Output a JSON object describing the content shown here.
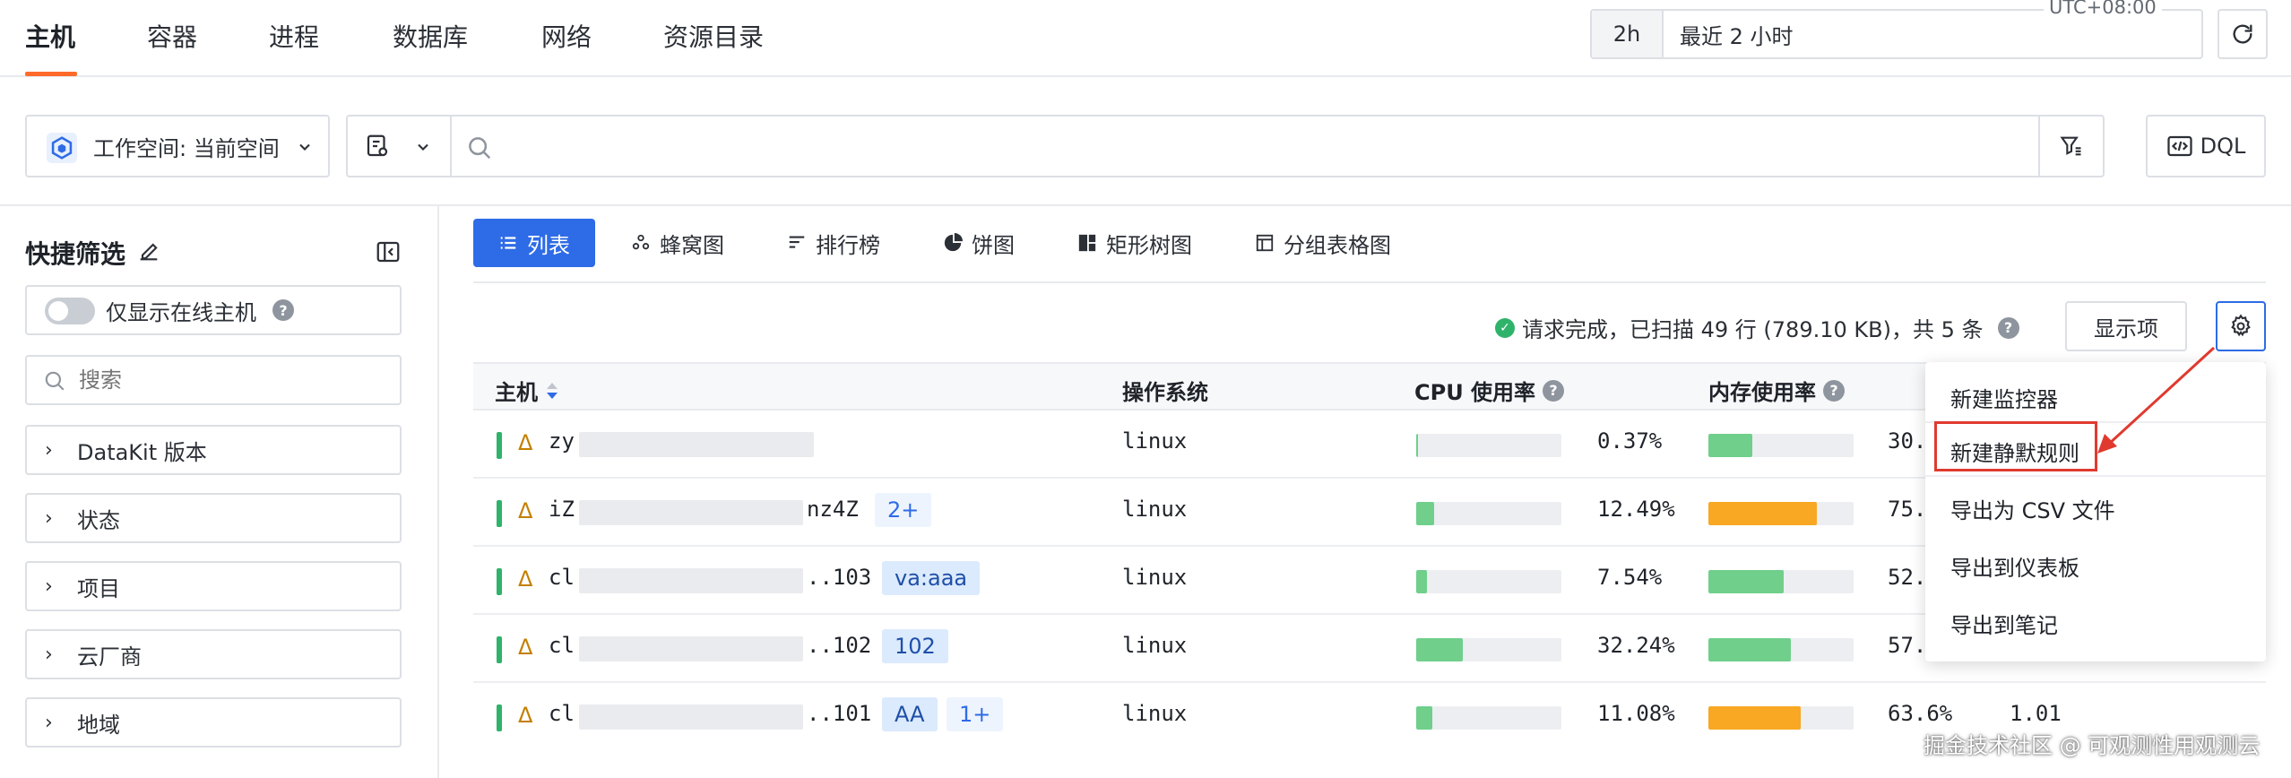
{
  "topnav": {
    "tabs": [
      {
        "label": "主机",
        "active": true
      },
      {
        "label": "容器"
      },
      {
        "label": "进程"
      },
      {
        "label": "数据库"
      },
      {
        "label": "网络"
      },
      {
        "label": "资源目录"
      }
    ]
  },
  "time": {
    "short": "2h",
    "range": "最近 2 小时",
    "timezone": "UTC+08:00"
  },
  "workspace": {
    "label": "工作空间: 当前空间"
  },
  "search": {
    "placeholder": ""
  },
  "dql_label": "DQL",
  "sidebar": {
    "title": "快捷筛选",
    "online_toggle_label": "仅显示在线主机",
    "online_toggle_on": false,
    "search_placeholder": "搜索",
    "groups": [
      "DataKit 版本",
      "状态",
      "项目",
      "云厂商",
      "地域"
    ]
  },
  "views": [
    "列表",
    "蜂窝图",
    "排行榜",
    "饼图",
    "矩形树图",
    "分组表格图"
  ],
  "status": {
    "text": "请求完成，已扫描 49 行 (789.10 KB)，共 5 条"
  },
  "show_columns_label": "显示项",
  "table": {
    "headers": {
      "host": "主机",
      "os": "操作系统",
      "cpu": "CPU 使用率",
      "mem": "内存使用率"
    },
    "rows": [
      {
        "host": "zy",
        "suffix": "",
        "tags": [],
        "os": "linux",
        "cpu": 0.37,
        "cpu_label": "0.37%",
        "mem": 30,
        "mem_label": "30.",
        "load": ""
      },
      {
        "host": "iZ",
        "suffix": "nz4Z",
        "tags": [
          "2+"
        ],
        "os": "linux",
        "cpu": 12.49,
        "cpu_label": "12.49%",
        "mem": 75,
        "mem_label": "75.",
        "load": ""
      },
      {
        "host": "cl",
        "suffix": "..103",
        "tags": [
          "va:aaa"
        ],
        "os": "linux",
        "cpu": 7.54,
        "cpu_label": "7.54%",
        "mem": 52,
        "mem_label": "52.",
        "load": ""
      },
      {
        "host": "cl",
        "suffix": "..102",
        "tags": [
          "102"
        ],
        "os": "linux",
        "cpu": 32.24,
        "cpu_label": "32.24%",
        "mem": 57,
        "mem_label": "57.",
        "load": ""
      },
      {
        "host": "cl",
        "suffix": "..101",
        "tags": [
          "AA",
          "1+"
        ],
        "os": "linux",
        "cpu": 11.08,
        "cpu_label": "11.08%",
        "mem": 63.6,
        "mem_label": "63.6%",
        "load": "1.01"
      }
    ]
  },
  "menu": {
    "items": [
      "新建监控器",
      "新建静默规则",
      "导出为 CSV 文件",
      "导出到仪表板",
      "导出到笔记"
    ],
    "highlighted": "新建静默规则"
  },
  "colors": {
    "accent": "#2e6be6",
    "tab_underline": "#ff6a2b",
    "ok": "#2fb36b",
    "mem_low": "#6fcf8b",
    "mem_high": "#f8a823",
    "annotation": "#e03a2f"
  },
  "watermark": "掘金技术社区 @ 可观测性用观测云"
}
